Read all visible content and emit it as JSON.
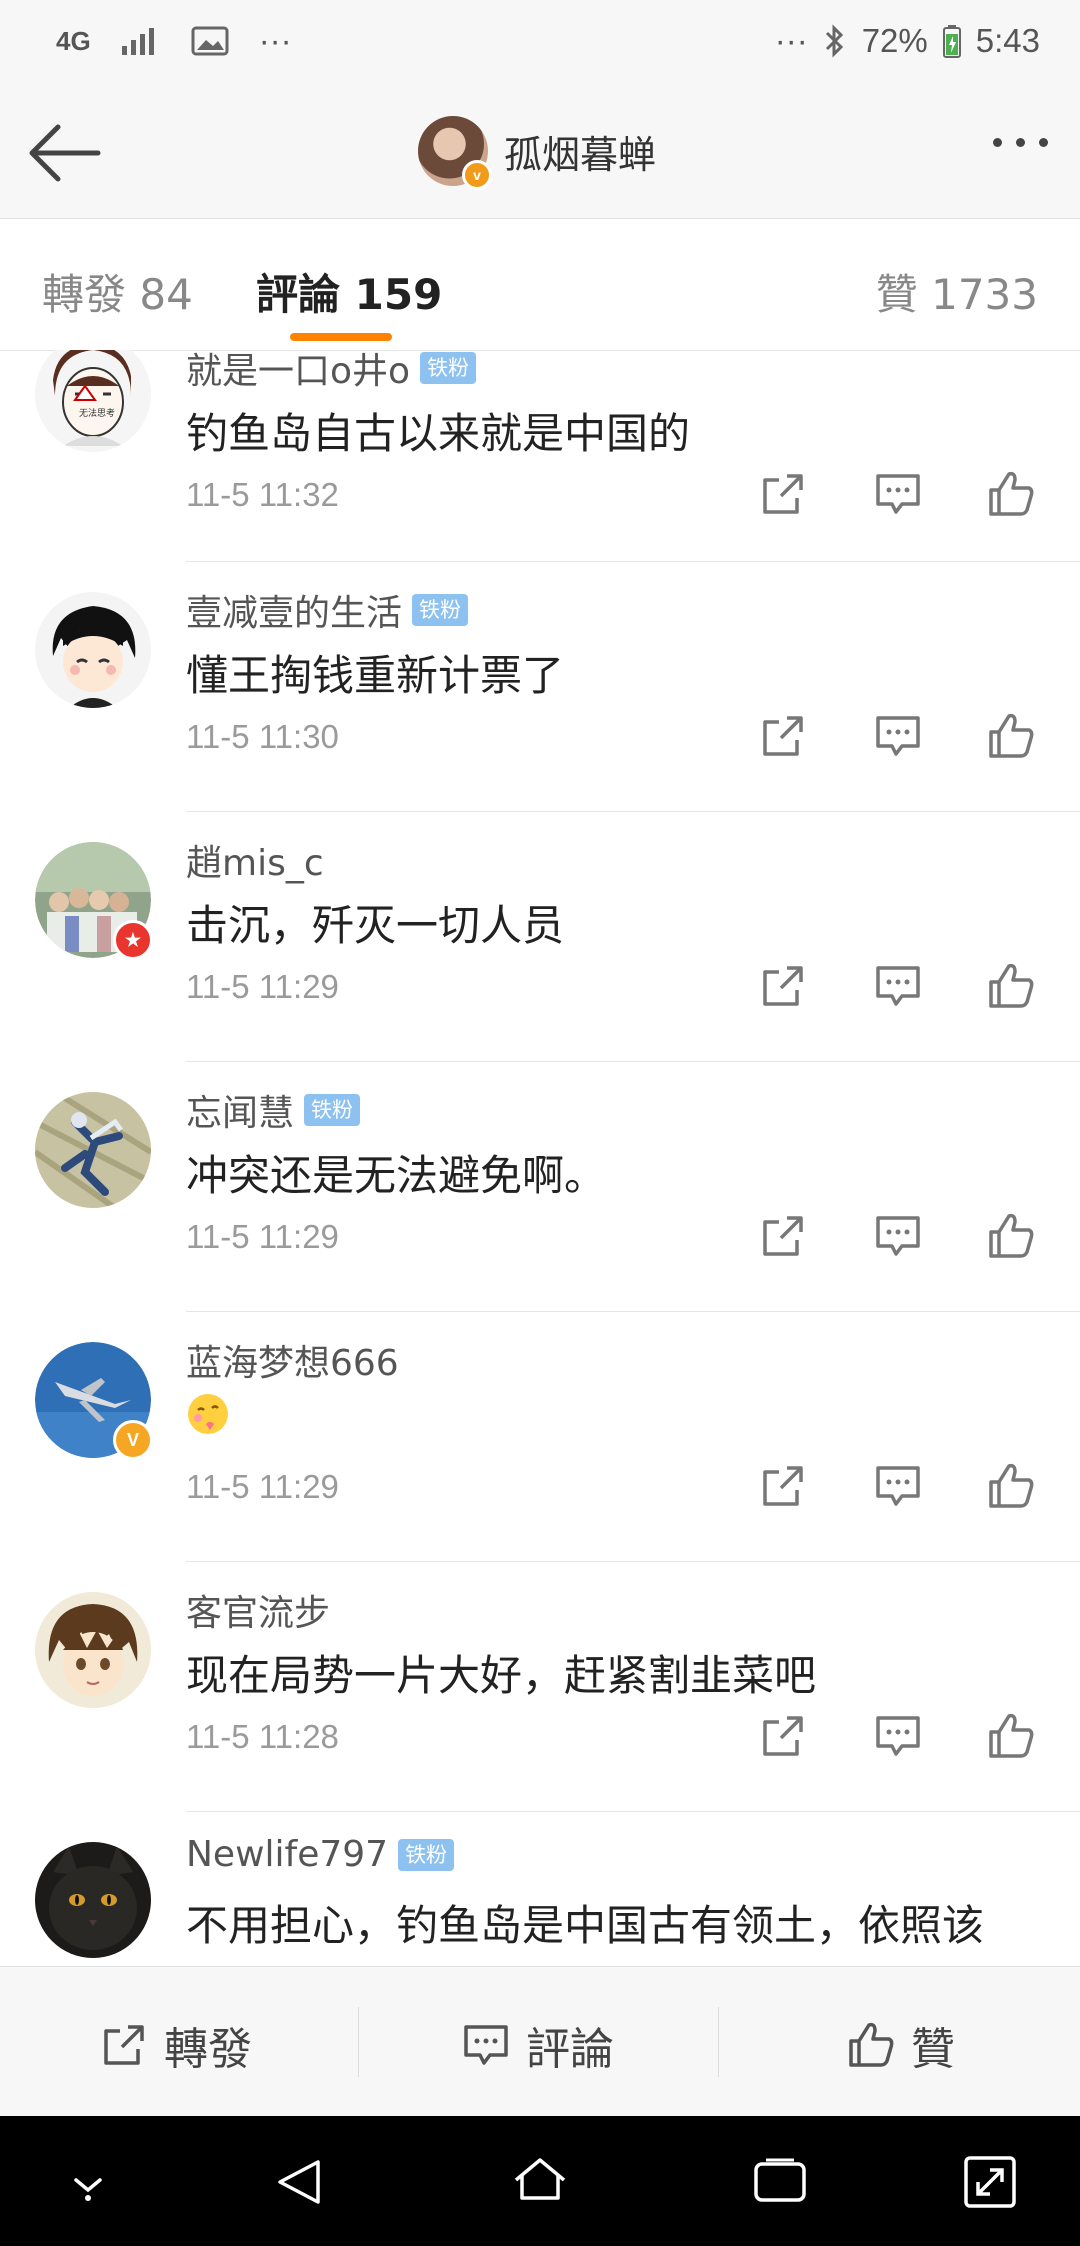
{
  "status_bar": {
    "network": "4G",
    "battery": "72%",
    "time": "5:43"
  },
  "header": {
    "user_name": "孤烟暮蝉"
  },
  "tabs": {
    "repost": "轉發 84",
    "comment": "評論 159",
    "like": "贊 1733"
  },
  "comments": [
    {
      "user": "就是一口o井o",
      "badge": "铁粉",
      "text": "钓鱼岛自古以来就是中国的",
      "time": "11-5 11:32"
    },
    {
      "user": "壹减壹的生活",
      "badge": "铁粉",
      "text": "懂王掏钱重新计票了",
      "time": "11-5 11:30"
    },
    {
      "user": "趙mis_c",
      "badge": "",
      "text": "击沉，歼灭一切人员",
      "time": "11-5 11:29"
    },
    {
      "user": "忘闻慧",
      "badge": "铁粉",
      "text": "冲突还是无法避免啊。",
      "time": "11-5 11:29"
    },
    {
      "user": "蓝海梦想666",
      "badge": "",
      "text": "",
      "time": "11-5 11:29"
    },
    {
      "user": "客官流步",
      "badge": "",
      "text": "现在局势一片大好，赶紧割韭菜吧",
      "time": "11-5 11:28"
    },
    {
      "user": "Newlife797",
      "badge": "铁粉",
      "text": "不用担心，钓鱼岛是中国古有领土，依照该",
      "time": ""
    }
  ],
  "toolbar": {
    "repost": "轉發",
    "comment": "評論",
    "like": "贊"
  },
  "colors": {
    "accent": "#ff8200",
    "fan_badge": "#8cc1f0",
    "verified_gold": "#f29a1a",
    "verified_red": "#e8352d"
  },
  "icons": [
    "back-arrow-icon",
    "more-dots-icon",
    "share-icon",
    "comment-icon",
    "like-icon",
    "emoji-icon"
  ]
}
